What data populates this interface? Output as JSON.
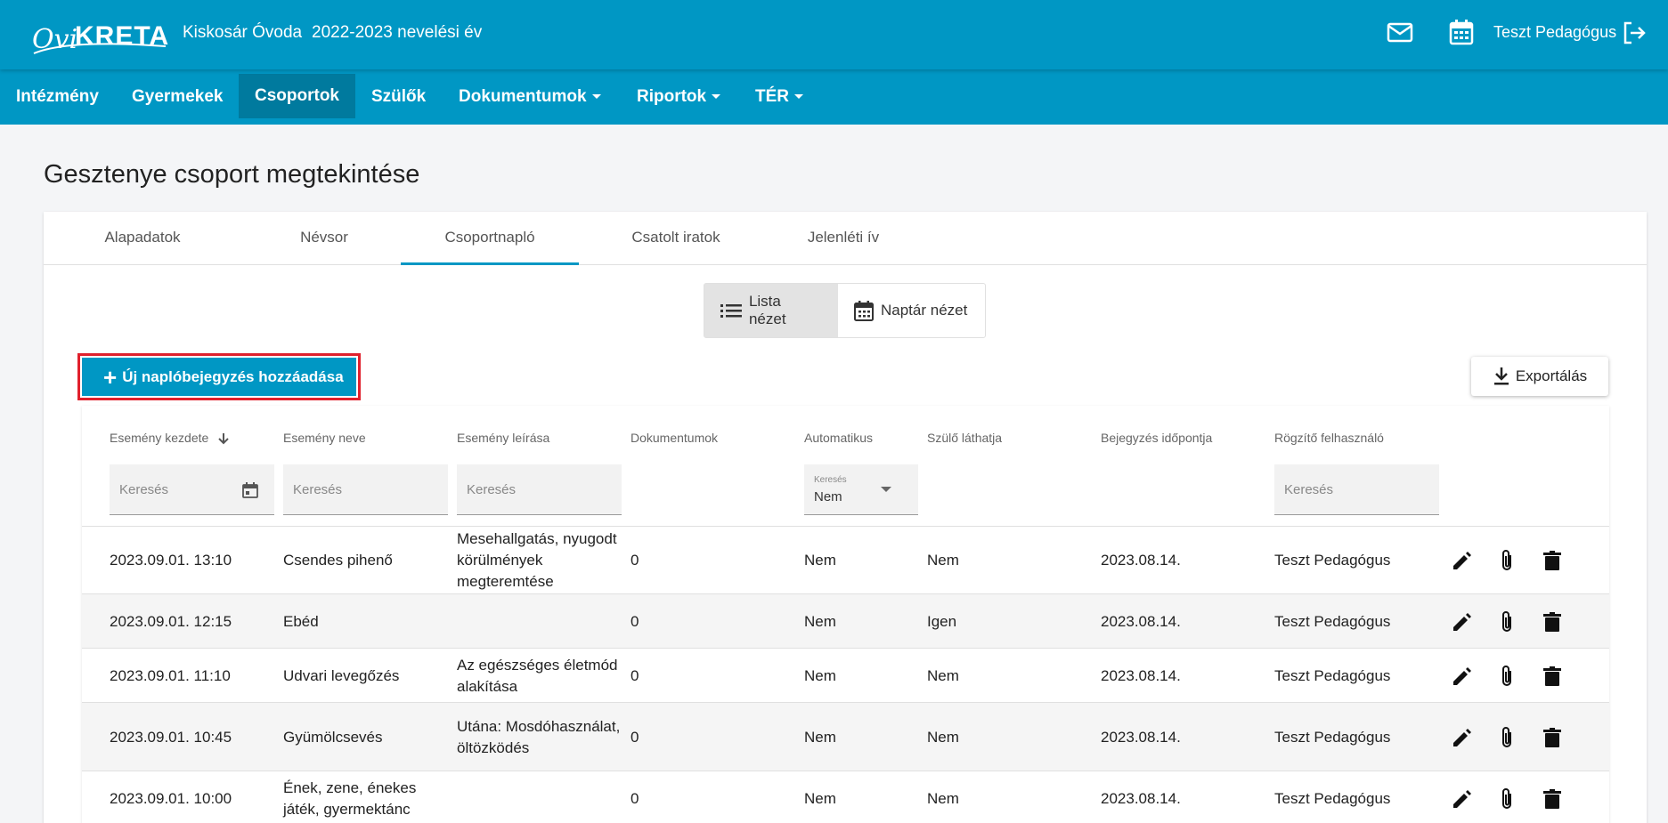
{
  "header": {
    "logo_text": "OviKRÉTA",
    "school_name": "Kiskosár Óvoda",
    "school_year": "2022-2023 nevelési év",
    "user_name": "Teszt Pedagógus",
    "icons": [
      "mail-icon",
      "calendar-icon",
      "logout-icon"
    ]
  },
  "nav": {
    "items": [
      {
        "label": "Intézmény"
      },
      {
        "label": "Gyermekek"
      },
      {
        "label": "Csoportok",
        "active": true
      },
      {
        "label": "Szülők"
      },
      {
        "label": "Dokumentumok",
        "dropdown": true
      },
      {
        "label": "Riportok",
        "dropdown": true
      },
      {
        "label": "TÉR",
        "dropdown": true
      }
    ]
  },
  "page": {
    "title": "Gesztenye csoport megtekintése"
  },
  "tabs": [
    {
      "label": "Alapadatok"
    },
    {
      "label": "Névsor"
    },
    {
      "label": "Csoportnapló",
      "active": true
    },
    {
      "label": "Csatolt iratok"
    },
    {
      "label": "Jelenléti ív"
    }
  ],
  "view_toggle": {
    "list_label": "Lista nézet",
    "calendar_label": "Naptár nézet",
    "selected": "list"
  },
  "toolbar": {
    "add_label": "Új naplóbejegyzés hozzáadása",
    "export_label": "Exportálás"
  },
  "table": {
    "headers": {
      "start": "Esemény kezdete",
      "name": "Esemény neve",
      "desc": "Esemény leírása",
      "docs": "Dokumentumok",
      "auto": "Automatikus",
      "parent": "Szülő láthatja",
      "entry": "Bejegyzés időpontja",
      "user": "Rögzítő felhasználó"
    },
    "filters": {
      "placeholder": "Keresés",
      "auto_select_label": "Keresés",
      "auto_select_value": "Nem"
    },
    "rows": [
      {
        "start": "2023.09.01. 13:10",
        "name": "Csendes pihenő",
        "desc": "Mesehallgatás, nyugodt körülmények megteremtése",
        "docs": "0",
        "auto": "Nem",
        "parent": "Nem",
        "entry": "2023.08.14.",
        "user": "Teszt Pedagógus"
      },
      {
        "start": "2023.09.01. 12:15",
        "name": "Ebéd",
        "desc": "",
        "docs": "0",
        "auto": "Nem",
        "parent": "Igen",
        "entry": "2023.08.14.",
        "user": "Teszt Pedagógus"
      },
      {
        "start": "2023.09.01. 11:10",
        "name": "Udvari levegőzés",
        "desc": "Az egészséges életmód alakítása",
        "docs": "0",
        "auto": "Nem",
        "parent": "Nem",
        "entry": "2023.08.14.",
        "user": "Teszt Pedagógus"
      },
      {
        "start": "2023.09.01. 10:45",
        "name": "Gyümölcsevés",
        "desc": "Utána: Mosdóhasználat, öltözködés",
        "docs": "0",
        "auto": "Nem",
        "parent": "Nem",
        "entry": "2023.08.14.",
        "user": "Teszt Pedagógus"
      },
      {
        "start": "2023.09.01. 10:00",
        "name": "Ének, zene, énekes játék, gyermektánc",
        "desc": "",
        "docs": "0",
        "auto": "Nem",
        "parent": "Nem",
        "entry": "2023.08.14.",
        "user": "Teszt Pedagógus"
      }
    ],
    "row_actions": [
      "edit-icon",
      "attach-icon",
      "delete-icon"
    ]
  },
  "colors": {
    "primary": "#0097c4",
    "active_nav": "#007a9e",
    "highlight": "#e0202c"
  }
}
